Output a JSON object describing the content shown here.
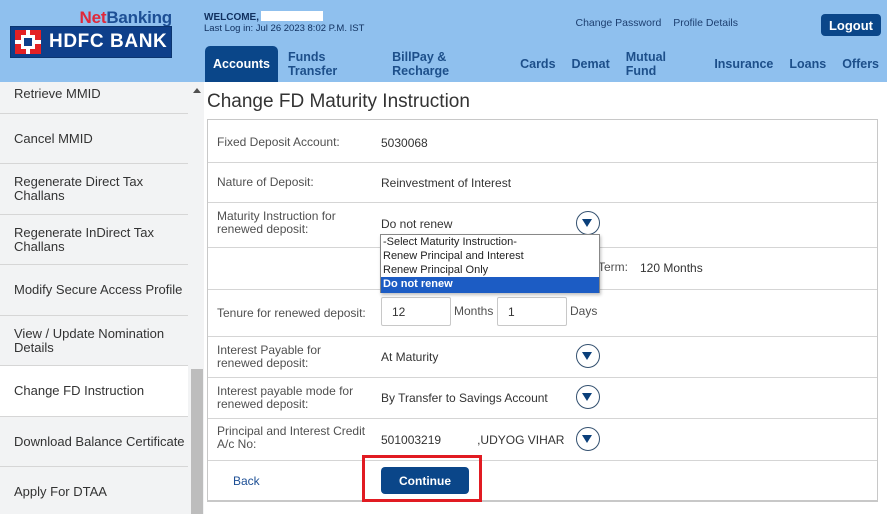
{
  "header": {
    "brand_net": "Net",
    "brand_banking": "Banking",
    "logo_text": "HDFC BANK",
    "welcome_label": "WELCOME,",
    "last_login": "Last Log in: Jul 26 2023 8:02 P.M. IST",
    "links": [
      "Change Password",
      "Profile Details"
    ],
    "logout_label": "Logout"
  },
  "nav": {
    "tabs": [
      {
        "label": "Accounts",
        "active": true
      },
      {
        "label": "Funds Transfer"
      },
      {
        "label": "BillPay & Recharge"
      },
      {
        "label": "Cards"
      },
      {
        "label": "Demat"
      },
      {
        "label": "Mutual Fund"
      },
      {
        "label": "Insurance"
      },
      {
        "label": "Loans"
      },
      {
        "label": "Offers"
      }
    ]
  },
  "sidebar": {
    "items": [
      {
        "label": "Retrieve MMID"
      },
      {
        "label": "Cancel MMID"
      },
      {
        "label": "Regenerate Direct Tax Challans"
      },
      {
        "label": "Regenerate InDirect Tax Challans"
      },
      {
        "label": "Modify Secure Access Profile"
      },
      {
        "label": "View / Update Nomination Details"
      },
      {
        "label": "Change FD Instruction",
        "active": true
      },
      {
        "label": "Download Balance Certificate"
      },
      {
        "label": "Apply For DTAA"
      }
    ]
  },
  "main": {
    "title": "Change FD Maturity Instruction",
    "fields": {
      "fd_account": {
        "label": "Fixed Deposit Account:",
        "value": "5030068"
      },
      "nature": {
        "label": "Nature of Deposit:",
        "value": "Reinvestment of Interest"
      },
      "maturity_instruction": {
        "label": "Maturity Instruction for renewed deposit:",
        "value": "Do not renew",
        "options": [
          "-Select Maturity Instruction-",
          "Renew Principal and Interest",
          "Renew Principal Only",
          "Do not renew"
        ],
        "selected_index": 3
      },
      "term": {
        "label": "Term:",
        "value": "120 Months"
      },
      "tenure": {
        "label": "Tenure for renewed deposit:",
        "months_value": "12",
        "months_unit": "Months",
        "days_value": "1",
        "days_unit": "Days"
      },
      "interest_payable": {
        "label": "Interest Payable for renewed deposit:",
        "value": "At Maturity"
      },
      "interest_mode": {
        "label": "Interest payable mode for renewed deposit:",
        "value": "By Transfer to Savings Account"
      },
      "credit_account": {
        "label": "Principal and Interest Credit A/c No:",
        "value_prefix": "501003219",
        "value_suffix": ",UDYOG VIHAR"
      }
    },
    "back_label": "Back",
    "continue_label": "Continue"
  },
  "colors": {
    "header_bg": "#8fc0ee",
    "brand_blue": "#0a4689",
    "brand_red": "#e32124",
    "highlight": "#e11b22",
    "selected_option": "#1c5cc4"
  }
}
